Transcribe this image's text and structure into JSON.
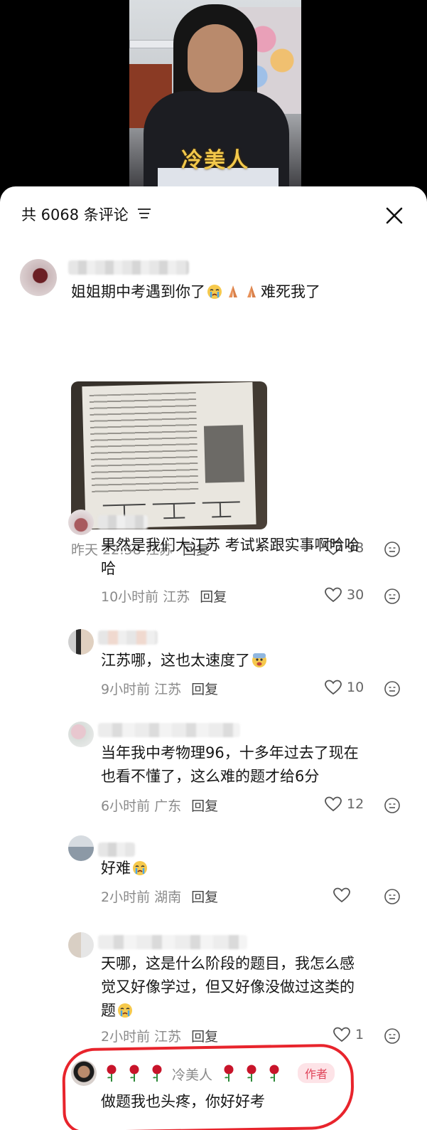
{
  "video": {
    "caption": "冷美人"
  },
  "header": {
    "count_label": "共 6068 条评论",
    "sort_icon": "sort-lines-icon",
    "close_icon": "close-icon"
  },
  "comments": [
    {
      "text": "姐姐期中考遇到你了",
      "text_tail": "难死我了",
      "time": "昨天 22:58",
      "location": "江苏",
      "reply": "回复",
      "likes": "98",
      "has_image": true
    },
    {
      "text": "果然是我们大江苏 考试紧跟实事啊哈哈",
      "text2": "哈",
      "time": "10小时前",
      "location": "江苏",
      "reply": "回复",
      "likes": "30"
    },
    {
      "text": "江苏哪，这也太速度了",
      "time": "9小时前",
      "location": "江苏",
      "reply": "回复",
      "likes": "10"
    },
    {
      "text": "当年我中考物理96，十多年过去了现在",
      "text2": "也看不懂了，这么难的题才给6分",
      "time": "6小时前",
      "location": "广东",
      "reply": "回复",
      "likes": "12"
    },
    {
      "text": "好难",
      "time": "2小时前",
      "location": "湖南",
      "reply": "回复",
      "likes": ""
    },
    {
      "text": "天哪，这是什么阶段的题目，我怎么感",
      "text2": "觉又好像学过，但又好像没做过这类的",
      "text3": "题",
      "time": "2小时前",
      "location": "江苏",
      "reply": "回复",
      "likes": "1"
    }
  ],
  "author_reply": {
    "name": "冷美人",
    "badge": "作者",
    "text": "做题我也头疼，你好好考"
  },
  "colors": {
    "accent_red": "#e8242c",
    "caption_gold": "#f2c84b",
    "badge_pink": "#fde3e7"
  }
}
